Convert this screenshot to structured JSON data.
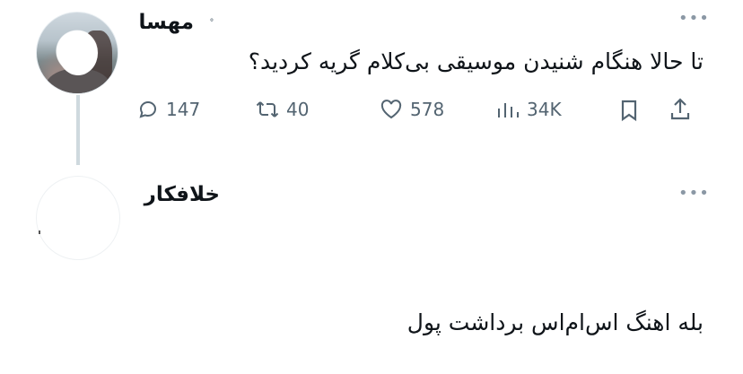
{
  "tweet": {
    "author_name": "مهسا",
    "verified_mark": "ᐤ",
    "more_glyph": "•••",
    "text": "تا حالا هنگام شنیدن موسیقی بی‌کلام گریه کردید؟",
    "stats": {
      "replies": "147",
      "retweets": "40",
      "likes": "578",
      "views": "34K"
    }
  },
  "reply": {
    "author_name": "خلافکار",
    "more_glyph": "•••",
    "text": "بله اهنگ اس‌ام‌اس برداشت پول"
  },
  "colors": {
    "text": "#0f1419",
    "secondary": "#536471",
    "thread_line": "#cfd9de"
  }
}
